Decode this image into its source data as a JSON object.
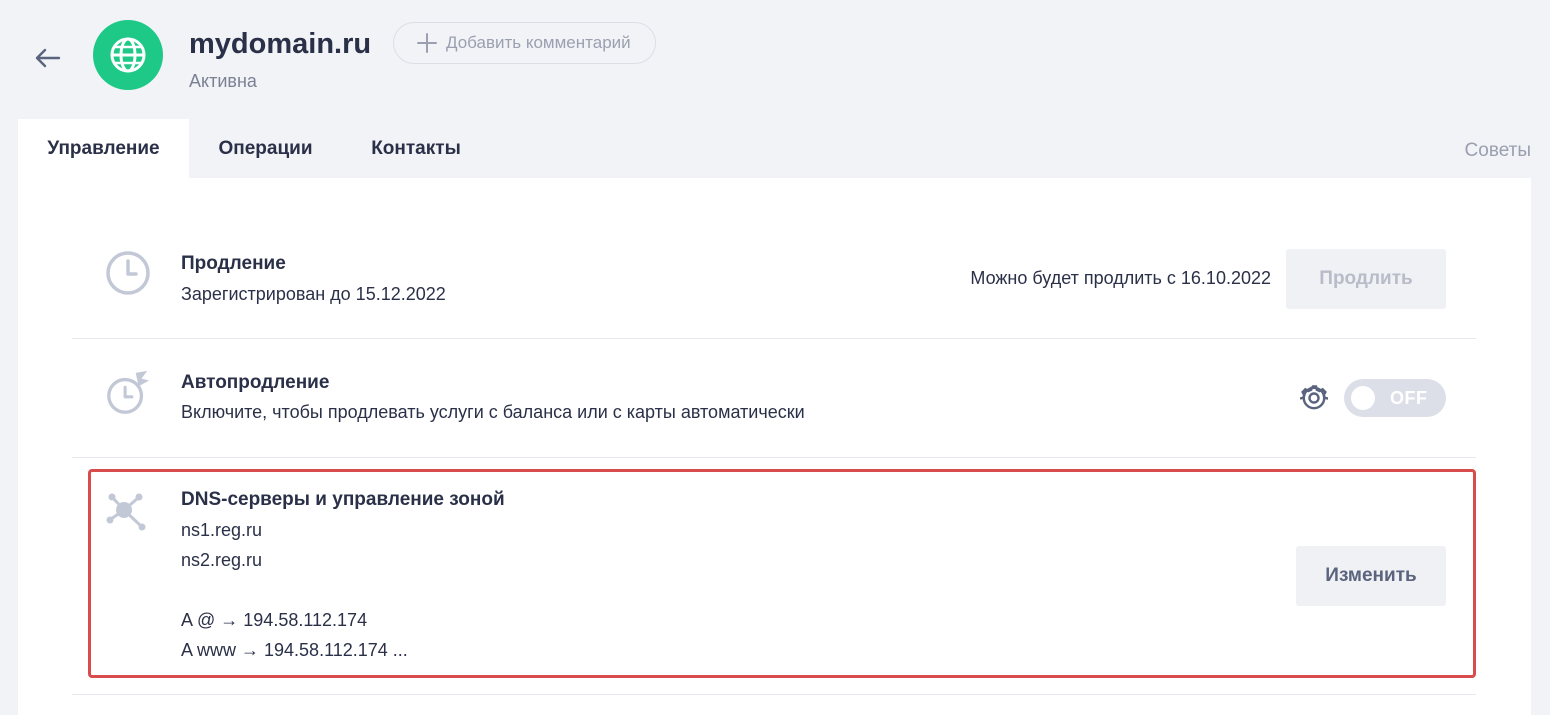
{
  "header": {
    "domain_name": "mydomain.ru",
    "status": "Активна",
    "add_comment_label": "Добавить комментарий",
    "avatar_color": "#1ec987"
  },
  "tabs": [
    {
      "label": "Управление",
      "active": true
    },
    {
      "label": "Операции",
      "active": false
    },
    {
      "label": "Контакты",
      "active": false
    }
  ],
  "tips_label": "Советы",
  "renewal": {
    "title": "Продление",
    "subtitle": "Зарегистрирован до 15.12.2022",
    "note": "Можно будет продлить с 16.10.2022",
    "button_label": "Продлить",
    "icon": "clock-icon"
  },
  "autorenew": {
    "title": "Автопродление",
    "subtitle": "Включите, чтобы продлевать услуги с баланса или с карты автоматически",
    "toggle_label": "OFF",
    "toggle_on": false,
    "icon": "auto-renew-clock-icon"
  },
  "dns": {
    "title": "DNS-серверы и управление зоной",
    "servers": [
      "ns1.reg.ru",
      "ns2.reg.ru"
    ],
    "records": [
      "A @ → 194.58.112.174",
      "A www → 194.58.112.174 ..."
    ],
    "button_label": "Изменить",
    "icon": "dns-network-icon",
    "highlight_color": "#d84c4c"
  }
}
